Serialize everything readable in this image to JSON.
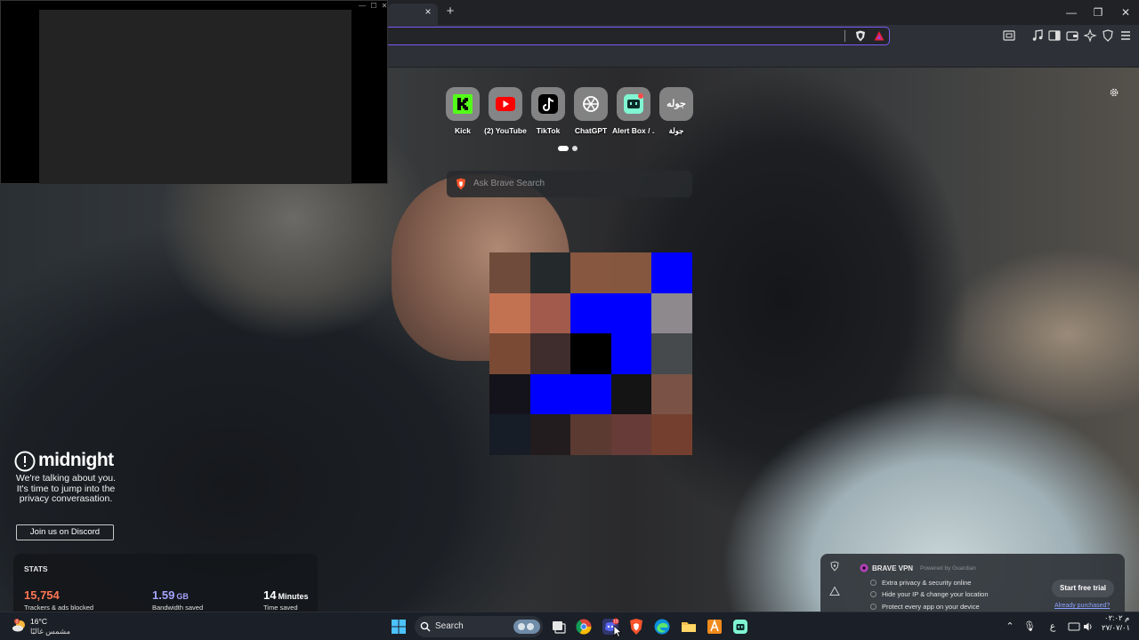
{
  "browser": {
    "tab_close_icon": "×",
    "new_tab_icon": "+",
    "window_controls": [
      "—",
      "❐",
      "✕"
    ],
    "accent_color": "#7c5cf5"
  },
  "pip": {
    "controls": [
      "—",
      "☐",
      "✕"
    ]
  },
  "top_sites": [
    {
      "label": "Kick",
      "icon": "kick-icon",
      "color": "#53fc18"
    },
    {
      "label": "(2) YouTube",
      "icon": "youtube-icon",
      "color": "#ff0000"
    },
    {
      "label": "TikTok",
      "icon": "tiktok-icon",
      "color": "#000000"
    },
    {
      "label": "ChatGPT",
      "icon": "chatgpt-icon",
      "color": "#ffffff"
    },
    {
      "label": "Alert Box / ...",
      "icon": "streamlabs-icon",
      "color": "#80f5d2"
    },
    {
      "label": "جولة",
      "tile_text": "جوله",
      "icon": "text-tile"
    }
  ],
  "search": {
    "placeholder": "Ask Brave Search"
  },
  "sponsor": {
    "brand": "midnight",
    "text": "We're talking about you. It's time to jump into the privacy converasation.",
    "cta": "Join us on Discord"
  },
  "stats": {
    "title": "STATS",
    "items": [
      {
        "value": "15,754",
        "unit": "",
        "label": "Trackers & ads blocked",
        "color": "#ff7654"
      },
      {
        "value": "1.59",
        "unit": "GB",
        "label": "Bandwidth saved",
        "color": "#a6a4ff"
      },
      {
        "value": "14",
        "unit": "Minutes",
        "label": "Time saved",
        "color": "#ffffff"
      }
    ]
  },
  "vpn": {
    "title": "BRAVE VPN",
    "powered_by": "Powered by  Guardian",
    "features": [
      "Extra privacy & security online",
      "Hide your IP & change your location",
      "Protect every app on your device"
    ],
    "cta": "Start free trial",
    "already": "Already purchased?"
  },
  "taskbar": {
    "weather_temp": "16°C",
    "weather_condition": "مشمس غالبًا",
    "weather_badge": "2",
    "search_label": "Search",
    "language": "ع",
    "time": "م ٠٢:٠٢",
    "date": "٢٧/٠٧/٠١",
    "notification_count": "10"
  }
}
